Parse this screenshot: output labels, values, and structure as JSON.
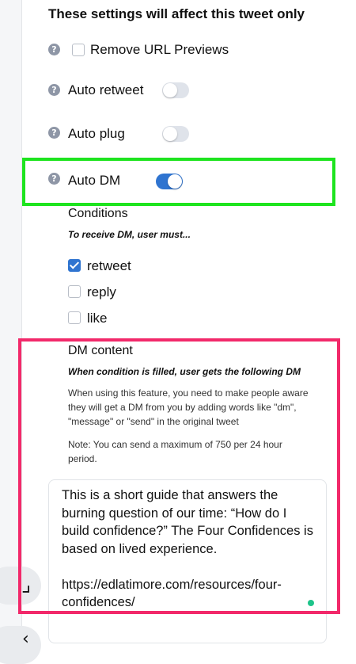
{
  "header": {
    "title": "These settings will affect this tweet only"
  },
  "settings": {
    "remove_url_previews": {
      "label": "Remove URL Previews",
      "checked": false
    },
    "auto_retweet": {
      "label": "Auto retweet",
      "enabled": false
    },
    "auto_plug": {
      "label": "Auto plug",
      "enabled": false
    },
    "auto_dm": {
      "label": "Auto DM",
      "enabled": true
    }
  },
  "help_icon_glyph": "?",
  "conditions": {
    "title": "Conditions",
    "subtitle": "To receive DM, user must...",
    "options": [
      {
        "label": "retweet",
        "checked": true
      },
      {
        "label": "reply",
        "checked": false
      },
      {
        "label": "like",
        "checked": false
      }
    ]
  },
  "dm_content": {
    "title": "DM content",
    "subtitle": "When condition is filled, user gets the following DM",
    "info": "When using this feature, you need to make people aware they will get a DM from you by adding words like \"dm\", \"message\" or \"send\" in the original tweet",
    "note": "Note: You can send a maximum of 750 per 24 hour period.",
    "message": "This is a short guide that answers the burning question of our time: “How do I build confidence?” The Four Confidences is based on lived experience.\n\nhttps://edlatimore.com/resources/four-confidences/"
  },
  "colors": {
    "toggle_on": "#2f74d0",
    "highlight_green": "#1ee41f",
    "highlight_pink": "#f2296a"
  }
}
